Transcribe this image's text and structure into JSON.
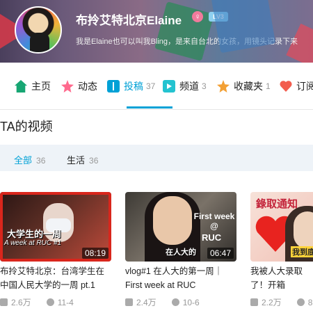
{
  "header": {
    "name": "布拎艾特北京Elaine",
    "gender_symbol": "♀",
    "level": "LV3",
    "bio": "我是Elaine也可以叫我Bling，是来自台北的女孩，用镜头记录下来"
  },
  "tabs": [
    {
      "label": "主页",
      "count": "",
      "icon": "home-icon"
    },
    {
      "label": "动态",
      "count": "",
      "icon": "activity-icon"
    },
    {
      "label": "投稿",
      "count": "37",
      "icon": "upload-icon"
    },
    {
      "label": "频道",
      "count": "3",
      "icon": "channel-icon"
    },
    {
      "label": "收藏夹",
      "count": "1",
      "icon": "favorite-icon"
    },
    {
      "label": "订阅",
      "count": "",
      "icon": "subscribe-icon"
    }
  ],
  "section": {
    "title": "TA的视频"
  },
  "filters": [
    {
      "label": "全部",
      "count": "36"
    },
    {
      "label": "生活",
      "count": "36"
    }
  ],
  "videos": [
    {
      "title": "布拎艾特北京：台湾学生在中国人民大学的一周 pt.1",
      "duration": "08:19",
      "views": "2.6万",
      "date": "11-4",
      "thumb_text": "大学生的一周",
      "thumb_sub": "A week at RUC #1"
    },
    {
      "title": "vlog#1 在人大的第一周｜First week at RUC",
      "duration": "06:47",
      "views": "2.4万",
      "date": "10-6",
      "thumb_text": "First week @",
      "thumb_sub": "RUC",
      "thumb_cn": "在人大的"
    },
    {
      "title": "我被人大录取了！开箱",
      "duration": "",
      "views": "2.2万",
      "date": "8",
      "thumb_text": "錄取通知",
      "thumb_sub": "我到底去哪"
    }
  ],
  "colors": {
    "accent": "#00a1d6",
    "meta": "#999999",
    "filter_bg": "#eef3f8"
  }
}
